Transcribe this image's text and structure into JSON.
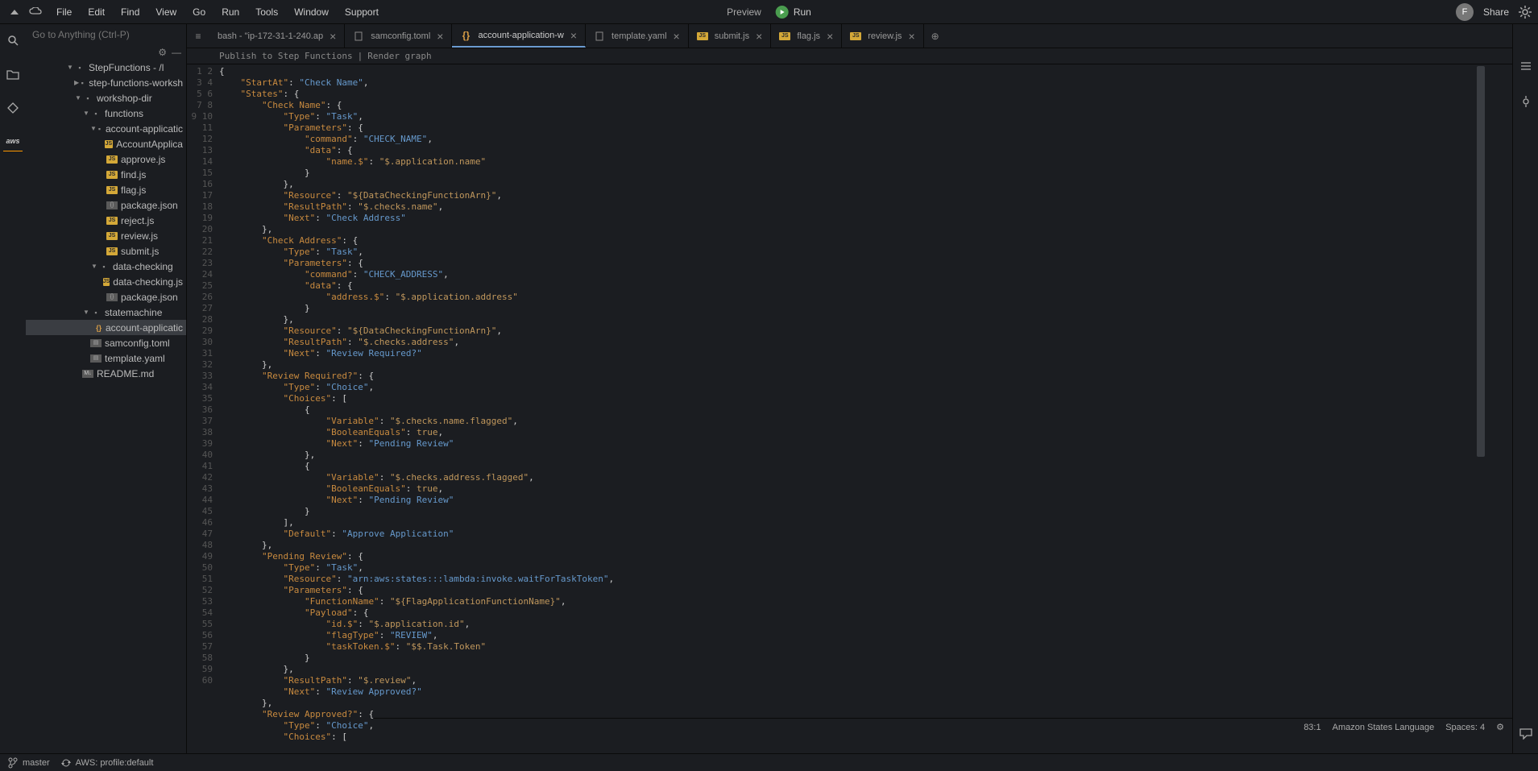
{
  "menubar": {
    "items": [
      "File",
      "Edit",
      "Find",
      "View",
      "Go",
      "Run",
      "Tools",
      "Window",
      "Support"
    ],
    "preview": "Preview",
    "run": "Run",
    "share": "Share",
    "avatar_letter": "F"
  },
  "search": {
    "placeholder": "Go to Anything (Ctrl-P)"
  },
  "tree": {
    "root_label": "StepFunctions - /l",
    "items": [
      {
        "depth": 1,
        "caret": "▶",
        "icon": "folder",
        "label": "step-functions-worksh"
      },
      {
        "depth": 1,
        "caret": "▼",
        "icon": "folder",
        "label": "workshop-dir"
      },
      {
        "depth": 2,
        "caret": "▼",
        "icon": "folder",
        "label": "functions"
      },
      {
        "depth": 3,
        "caret": "▼",
        "icon": "folder",
        "label": "account-applicatic"
      },
      {
        "depth": 4,
        "caret": "",
        "icon": "js",
        "label": "AccountApplica"
      },
      {
        "depth": 4,
        "caret": "",
        "icon": "js",
        "label": "approve.js"
      },
      {
        "depth": 4,
        "caret": "",
        "icon": "js",
        "label": "find.js"
      },
      {
        "depth": 4,
        "caret": "",
        "icon": "js",
        "label": "flag.js"
      },
      {
        "depth": 4,
        "caret": "",
        "icon": "json",
        "label": "package.json"
      },
      {
        "depth": 4,
        "caret": "",
        "icon": "js",
        "label": "reject.js"
      },
      {
        "depth": 4,
        "caret": "",
        "icon": "js",
        "label": "review.js"
      },
      {
        "depth": 4,
        "caret": "",
        "icon": "js",
        "label": "submit.js"
      },
      {
        "depth": 3,
        "caret": "▼",
        "icon": "folder",
        "label": "data-checking"
      },
      {
        "depth": 4,
        "caret": "",
        "icon": "js",
        "label": "data-checking.js"
      },
      {
        "depth": 4,
        "caret": "",
        "icon": "json",
        "label": "package.json"
      },
      {
        "depth": 2,
        "caret": "▼",
        "icon": "folder",
        "label": "statemachine"
      },
      {
        "depth": 3,
        "caret": "",
        "icon": "braces",
        "label": "account-applicatic",
        "selected": true
      },
      {
        "depth": 2,
        "caret": "",
        "icon": "toml",
        "label": "samconfig.toml"
      },
      {
        "depth": 2,
        "caret": "",
        "icon": "yaml",
        "label": "template.yaml"
      },
      {
        "depth": 1,
        "caret": "",
        "icon": "md",
        "label": "README.md"
      }
    ]
  },
  "tabs": [
    {
      "icon": "term",
      "label": "bash - \"ip-172-31-1-240.ap",
      "close": "×"
    },
    {
      "icon": "toml",
      "label": "samconfig.toml",
      "close": "×"
    },
    {
      "icon": "braces",
      "label": "account-application-w",
      "close": "×",
      "active": true
    },
    {
      "icon": "yaml",
      "label": "template.yaml",
      "close": "×"
    },
    {
      "icon": "js",
      "label": "submit.js",
      "close": "×"
    },
    {
      "icon": "js",
      "label": "flag.js",
      "close": "×"
    },
    {
      "icon": "js",
      "label": "review.js",
      "close": "×"
    }
  ],
  "subtoolbar": {
    "publish": "Publish to Step Functions",
    "sep": "|",
    "render": "Render graph"
  },
  "code_lines": [
    "{",
    "    \"StartAt\": \"Check Name\",",
    "    \"States\": {",
    "        \"Check Name\": {",
    "            \"Type\": \"Task\",",
    "            \"Parameters\": {",
    "                \"command\": \"CHECK_NAME\",",
    "                \"data\": {",
    "                    \"name.$\": \"$.application.name\"",
    "                }",
    "            },",
    "            \"Resource\": \"${DataCheckingFunctionArn}\",",
    "            \"ResultPath\": \"$.checks.name\",",
    "            \"Next\": \"Check Address\"",
    "        },",
    "        \"Check Address\": {",
    "            \"Type\": \"Task\",",
    "            \"Parameters\": {",
    "                \"command\": \"CHECK_ADDRESS\",",
    "                \"data\": {",
    "                    \"address.$\": \"$.application.address\"",
    "                }",
    "            },",
    "            \"Resource\": \"${DataCheckingFunctionArn}\",",
    "            \"ResultPath\": \"$.checks.address\",",
    "            \"Next\": \"Review Required?\"",
    "        },",
    "        \"Review Required?\": {",
    "            \"Type\": \"Choice\",",
    "            \"Choices\": [",
    "                {",
    "                    \"Variable\": \"$.checks.name.flagged\",",
    "                    \"BooleanEquals\": true,",
    "                    \"Next\": \"Pending Review\"",
    "                },",
    "                {",
    "                    \"Variable\": \"$.checks.address.flagged\",",
    "                    \"BooleanEquals\": true,",
    "                    \"Next\": \"Pending Review\"",
    "                }",
    "            ],",
    "            \"Default\": \"Approve Application\"",
    "        },",
    "        \"Pending Review\": {",
    "            \"Type\": \"Task\",",
    "            \"Resource\": \"arn:aws:states:::lambda:invoke.waitForTaskToken\",",
    "            \"Parameters\": {",
    "                \"FunctionName\": \"${FlagApplicationFunctionName}\",",
    "                \"Payload\": {",
    "                    \"id.$\": \"$.application.id\",",
    "                    \"flagType\": \"REVIEW\",",
    "                    \"taskToken.$\": \"$$.Task.Token\"",
    "                }",
    "            },",
    "            \"ResultPath\": \"$.review\",",
    "            \"Next\": \"Review Approved?\"",
    "        },",
    "        \"Review Approved?\": {",
    "            \"Type\": \"Choice\",",
    "            \"Choices\": ["
  ],
  "status": {
    "pos": "83:1",
    "lang": "Amazon States Language",
    "spaces": "Spaces: 4"
  },
  "bottom": {
    "branch": "master",
    "aws": "AWS: profile:default"
  }
}
